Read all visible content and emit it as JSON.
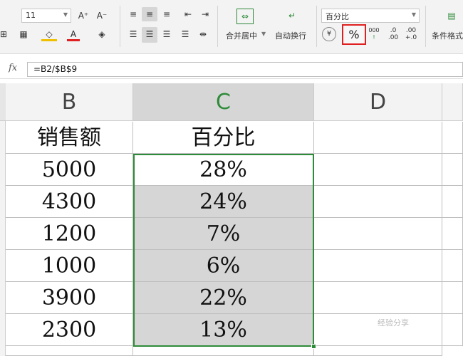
{
  "ribbon": {
    "font_size": "11",
    "number_format": "百分比",
    "merge_center_label": "合并居中",
    "auto_wrap_label": "自动换行",
    "conditional_format_label": "条件格式",
    "percent_symbol": "%",
    "currency_symbol": "¥",
    "increase_decimal_top": ".0",
    "increase_decimal_bottom": ".00",
    "decrease_decimal_top": ".00",
    "decrease_decimal_bottom": "+.0",
    "thousands_top": "000",
    "thousands_bottom": "!",
    "text_color_letter": "A",
    "grow_font": "A⁺",
    "shrink_font": "A⁻"
  },
  "formula_bar": {
    "fx_label": "fx",
    "formula": "=B2/$B$9"
  },
  "grid": {
    "columns": [
      "B",
      "C",
      "D"
    ],
    "header_row": {
      "b": "销售额",
      "c": "百分比"
    },
    "rows": [
      {
        "b": "5000",
        "c": "28%"
      },
      {
        "b": "4300",
        "c": "24%"
      },
      {
        "b": "1200",
        "c": "7%"
      },
      {
        "b": "1000",
        "c": "6%"
      },
      {
        "b": "3900",
        "c": "22%"
      },
      {
        "b": "2300",
        "c": "13%"
      }
    ]
  },
  "colors": {
    "selection_border": "#2e8b3a",
    "selection_fill": "#d6d6d6",
    "highlight_box": "#e02020"
  },
  "watermark": "经验分享"
}
